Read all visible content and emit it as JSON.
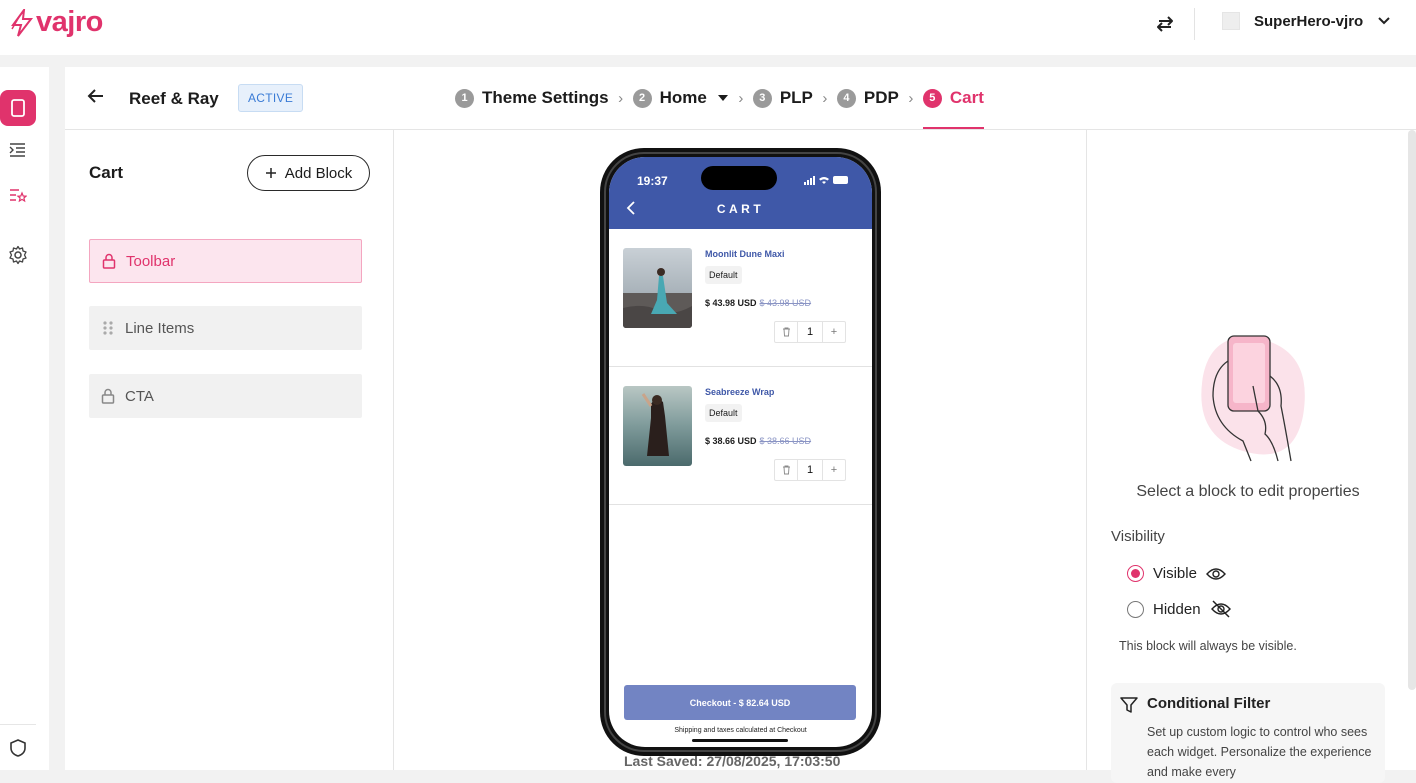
{
  "brand": {
    "logo_text": "vajro",
    "accent": "#e0336c"
  },
  "topbar": {
    "store_name": "SuperHero-vjro",
    "swap_icon": "swap-arrows-icon",
    "dropdown_icon": "chevron-down-icon"
  },
  "rail": {
    "items": [
      {
        "name": "phone-preview-icon",
        "active": true
      },
      {
        "name": "list-indent-icon",
        "active": false
      },
      {
        "name": "star-list-icon",
        "active": false
      },
      {
        "name": "gear-icon",
        "active": false
      }
    ],
    "bottom_icon": "shield-icon"
  },
  "header": {
    "theme_name": "Reef & Ray",
    "status_badge": "ACTIVE",
    "steps": [
      {
        "num": "1",
        "label": "Theme Settings"
      },
      {
        "num": "2",
        "label": "Home"
      },
      {
        "num": "3",
        "label": "PLP"
      },
      {
        "num": "4",
        "label": "PDP"
      },
      {
        "num": "5",
        "label": "Cart"
      }
    ],
    "active_step": "5"
  },
  "left_panel": {
    "title": "Cart",
    "add_block_label": "Add Block",
    "blocks": [
      {
        "label": "Toolbar",
        "icon": "lock-icon",
        "active": true
      },
      {
        "label": "Line Items",
        "icon": "drag-handle-icon",
        "active": false
      },
      {
        "label": "CTA",
        "icon": "lock-icon",
        "active": false
      }
    ]
  },
  "preview": {
    "status_time": "19:37",
    "app_title": "CART",
    "items": [
      {
        "name": "Moonlit Dune Maxi",
        "variant": "Default",
        "price": "$ 43.98 USD",
        "compare_price": "$ 43.98 USD",
        "qty": "1"
      },
      {
        "name": "Seabreeze Wrap",
        "variant": "Default",
        "price": "$ 38.66 USD",
        "compare_price": "$ 38.66 USD",
        "qty": "1"
      }
    ],
    "checkout_label": "Checkout  -  $ 82.64 USD",
    "shipping_note": "Shipping and taxes calculated at Checkout",
    "last_saved": "Last Saved:  27/08/2025, 17:03:50"
  },
  "right_panel": {
    "select_message": "Select a block to edit properties",
    "visibility_label": "Visibility",
    "options": [
      {
        "label": "Visible",
        "icon": "eye-icon",
        "selected": true
      },
      {
        "label": "Hidden",
        "icon": "eye-off-icon",
        "selected": false
      }
    ],
    "visibility_note": "This block will always be visible.",
    "conditional_filter": {
      "title": "Conditional Filter",
      "description": "Set up custom logic to control who sees each widget. Personalize the experience and make every"
    }
  }
}
